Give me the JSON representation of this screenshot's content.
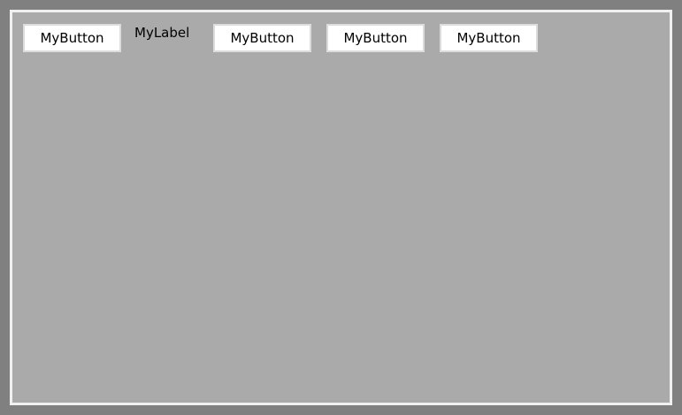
{
  "toolbar": {
    "button_1_label": "MyButton",
    "label_text": "MyLabel",
    "button_2_label": "MyButton",
    "button_3_label": "MyButton",
    "button_4_label": "MyButton"
  },
  "colors": {
    "window_background": "#808080",
    "panel_background": "#aaaaaa",
    "panel_border": "#f0f0f0",
    "button_background": "#ffffff",
    "button_border": "#dcdcdc"
  }
}
